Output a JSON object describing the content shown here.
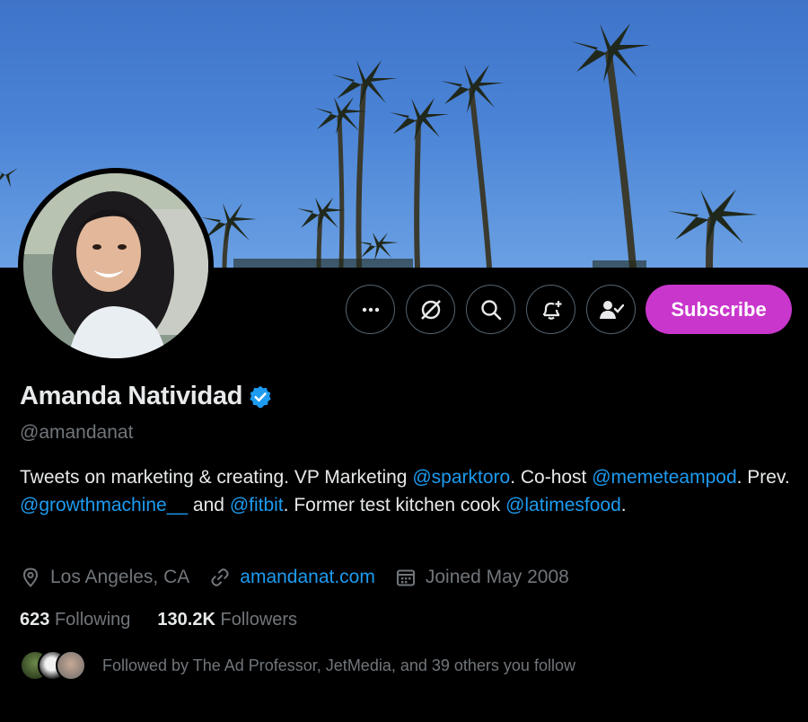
{
  "profile": {
    "name": "Amanda Natividad",
    "handle": "@amandanat",
    "verified": true,
    "bio": [
      {
        "type": "text",
        "value": "Tweets on marketing & creating. VP Marketing "
      },
      {
        "type": "mention",
        "value": "@sparktoro"
      },
      {
        "type": "text",
        "value": ". Co-host "
      },
      {
        "type": "mention",
        "value": "@memeteampod"
      },
      {
        "type": "text",
        "value": ". Prev. "
      },
      {
        "type": "mention",
        "value": "@growthmachine__"
      },
      {
        "type": "text",
        "value": " and "
      },
      {
        "type": "mention",
        "value": "@fitbit"
      },
      {
        "type": "text",
        "value": ". Former test kitchen cook "
      },
      {
        "type": "mention",
        "value": "@latimesfood"
      },
      {
        "type": "text",
        "value": "."
      }
    ],
    "location": "Los Angeles, CA",
    "website": "amandanat.com",
    "joined": "Joined May 2008"
  },
  "stats": {
    "following_count": "623",
    "following_label": "Following",
    "followers_count": "130.2K",
    "followers_label": "Followers"
  },
  "followed_by": "Followed by The Ad Professor, JetMedia, and 39 others you follow",
  "actions": {
    "more_icon": "more-icon",
    "grok_icon": "grok-icon",
    "search_icon": "search-icon",
    "notify_icon": "bell-plus-icon",
    "following_icon": "person-check-icon",
    "subscribe_label": "Subscribe"
  },
  "colors": {
    "accent": "#1d9bf0",
    "subscribe": "#c936cc",
    "background": "#000000",
    "muted": "#71767b"
  }
}
